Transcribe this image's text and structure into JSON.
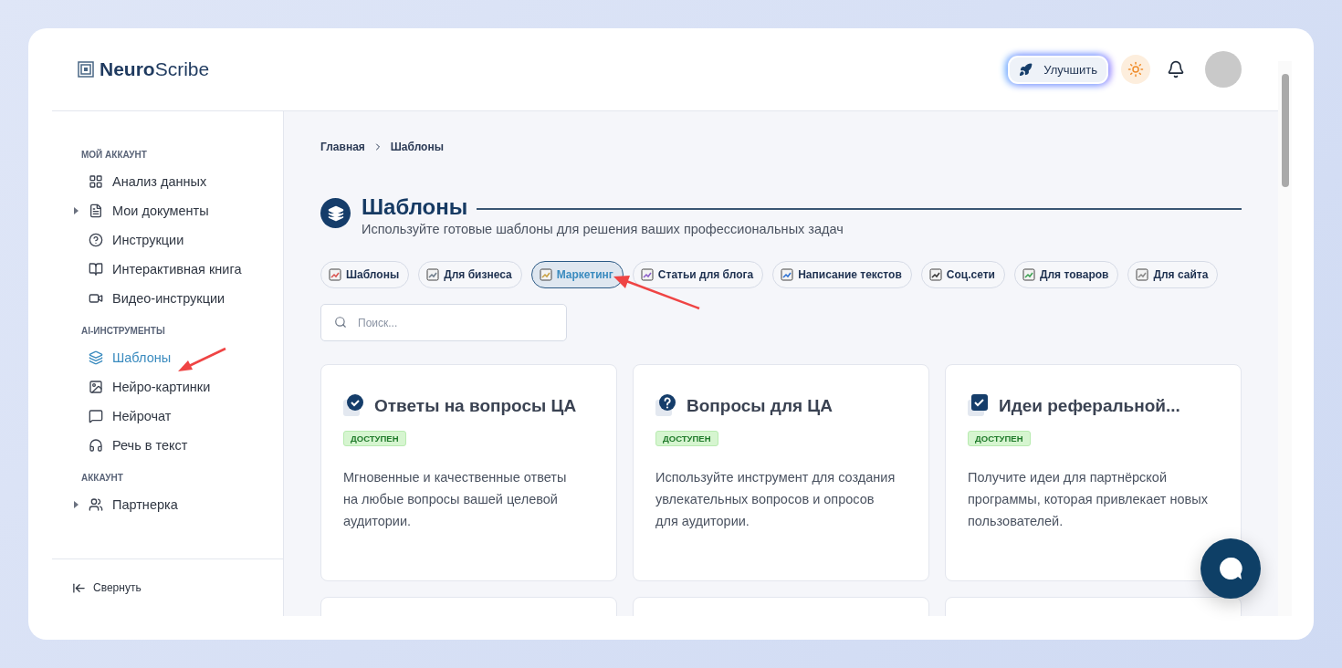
{
  "logo": "**Neuro**Scribe",
  "header": {
    "upgrade_button": "Улучшить"
  },
  "sidebar": {
    "sections": [
      {
        "title": "МОЙ АККАУНТ",
        "items": [
          {
            "label": "Анализ данных",
            "kind": "link",
            "selected": false
          },
          {
            "label": "Мои документы",
            "kind": "group",
            "selected": false
          },
          {
            "label": "Инструкции",
            "kind": "link",
            "selected": false
          },
          {
            "label": "Интерактивная книга",
            "kind": "link",
            "selected": false
          },
          {
            "label": "Видео-инструкции",
            "kind": "link",
            "selected": false
          }
        ]
      },
      {
        "title": "AI-ИНСТРУМЕНТЫ",
        "items": [
          {
            "label": "Шаблоны",
            "kind": "link",
            "selected": true
          },
          {
            "label": "Нейро-картинки",
            "kind": "link",
            "selected": false
          },
          {
            "label": "Нейрочат",
            "kind": "link",
            "selected": false
          },
          {
            "label": "Речь в текст",
            "kind": "link",
            "selected": false
          }
        ]
      },
      {
        "title": "АККАУНТ",
        "items": [
          {
            "label": "Партнерка",
            "kind": "group",
            "selected": false
          }
        ]
      }
    ],
    "collapse": "Свернуть"
  },
  "breadcrumb": [
    "Главная",
    "Шаблоны"
  ],
  "page": {
    "title": "Шаблоны",
    "subtitle": "Используйте готовые шаблоны для решения ваших профессиональных задач"
  },
  "chips": [
    {
      "label": "Шаблоны",
      "selected": false
    },
    {
      "label": "Для бизнеса",
      "selected": false
    },
    {
      "label": "Маркетинг",
      "selected": true
    },
    {
      "label": "Статьи для блога",
      "selected": false
    },
    {
      "label": "Написание текстов",
      "selected": false
    },
    {
      "label": "Соц.сети",
      "selected": false
    },
    {
      "label": "Для товаров",
      "selected": false
    },
    {
      "label": "Для сайта",
      "selected": false
    }
  ],
  "search": {
    "placeholder": "Поиск..."
  },
  "cards": [
    {
      "title": "Ответы на вопросы ЦА",
      "badge": "ДОСТУПЕН",
      "description": "Мгновенные и качественные ответы на любые вопросы вашей целевой аудитории."
    },
    {
      "title": "Вопросы для ЦА",
      "badge": "ДОСТУПЕН",
      "description": "Используйте инструмент для создания увлекательных вопросов и опросов для аудитории."
    },
    {
      "title": "Идеи реферальной...",
      "badge": "ДОСТУПЕН",
      "description": "Получите идеи для партнёрской программы, которая привлекает новых пользователей."
    }
  ]
}
